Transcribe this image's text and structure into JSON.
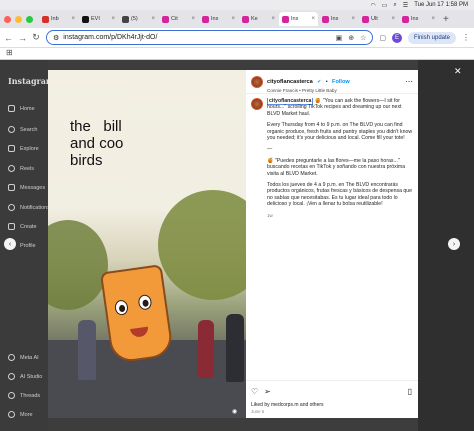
{
  "menubar": {
    "date_time": "Tue Jun 17  1:58 PM"
  },
  "tabs": [
    {
      "label": "Inb",
      "color": "#d93025"
    },
    {
      "label": "EVI",
      "color": "#111111"
    },
    {
      "label": "(5)",
      "color": "#444444"
    },
    {
      "label": "Cit",
      "color": "#d6249f"
    },
    {
      "label": "Ins",
      "color": "#d6249f"
    },
    {
      "label": "Ke",
      "color": "#d6249f"
    },
    {
      "label": "Ins",
      "color": "#d6249f"
    },
    {
      "label": "Ins",
      "color": "#d6249f"
    },
    {
      "label": "Ult",
      "color": "#d6249f"
    },
    {
      "label": "Ins",
      "color": "#d6249f"
    }
  ],
  "addressbar": {
    "url": "instagram.com/p/DKh4rJjt-dO/",
    "finish_label": "Finish update",
    "profile_initial": "E"
  },
  "sidebar": {
    "logo": "Instagram",
    "items": [
      "Home",
      "Search",
      "Explore",
      "Reels",
      "Messages",
      "Notifications",
      "Create",
      "Profile"
    ],
    "bottom_items": [
      "Meta AI",
      "AI Studio",
      "Threads",
      "More"
    ]
  },
  "photo": {
    "overlay_text": "the   bill\nand coo\nbirds"
  },
  "post": {
    "username": "cityoflancasterca",
    "follow": "Follow",
    "subtitle": "Connie Francis • Pretty Little Baby",
    "caption_user": "cityoflancasterca",
    "caption_paragraphs": [
      "🍯 \"You can ask the flowers—I sit for hours...\" scrolling TikTok recipes and dreaming up our next BLVD Market haul.",
      "Every Thursday from 4 to 9 p.m. on The BLVD you can find organic produce, fresh fruits and pantry staples you didn't know you needed; it's your delicious and local. Come fill your tote!",
      "—",
      "🍯 \"Puedes preguntarle a las flores—me la paso horas...\" buscando recetas en TikTok y soñando con nuestra próxima visita al BLVD Market.",
      "Todos los jueves de 4 a 9 p.m. en The BLVD encontrarás productos orgánicos, frutas frescas y básicos de despensa que no sabías que necesitabas. Es tu lugar ideal para todo lo delicioso y local. ¡Ven a llenar tu bolsa reutilizable!"
    ],
    "caption_time": "1w",
    "likes_text": "Liked by medcorps.m and others",
    "date": "June 5"
  },
  "colors": {
    "accent": "#0095f6",
    "overlay_bg": "#3d3d3d"
  }
}
